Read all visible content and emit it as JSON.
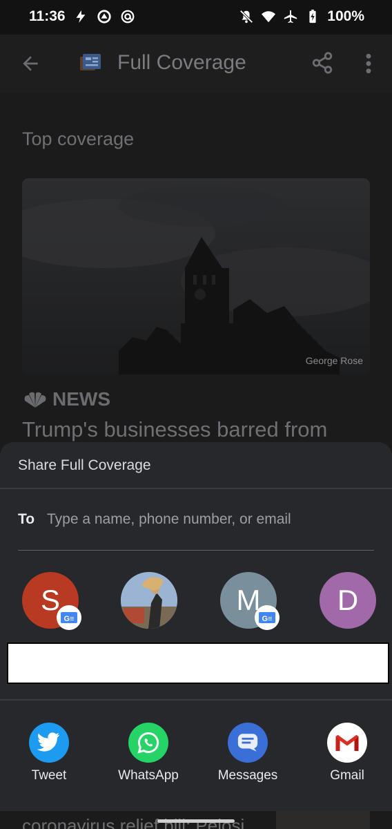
{
  "status_bar": {
    "time": "11:36",
    "battery": "100%",
    "left_icons": [
      "flash-icon",
      "sync-app-icon",
      "at-sign-icon"
    ],
    "right_icons": [
      "bell-off-icon",
      "wifi-icon",
      "airplane-icon",
      "battery-charging-icon"
    ]
  },
  "app_bar": {
    "title": "Full Coverage",
    "icons": [
      "back-arrow-icon",
      "google-news-logo-icon",
      "share-icon",
      "more-vert-icon"
    ]
  },
  "content": {
    "section_title": "Top coverage",
    "photo_credit": "George Rose",
    "source": "NEWS",
    "headline": "Trump's businesses barred from",
    "peek_text": "coronavirus relief bill: Pelosi"
  },
  "share_sheet": {
    "title": "Share Full Coverage",
    "to_label": "To",
    "to_placeholder": "Type a name, phone number, or email",
    "contacts": [
      {
        "initial": "S",
        "color": "#b83a22",
        "badge": "G≡"
      },
      {
        "initial": "",
        "color": "#8aa6c8",
        "badge": ""
      },
      {
        "initial": "M",
        "color": "#7a8f9c",
        "badge": "G≡"
      },
      {
        "initial": "D",
        "color": "#a06aa8",
        "badge": ""
      }
    ],
    "apps": [
      {
        "label": "Tweet",
        "color": "#1d9bf0"
      },
      {
        "label": "WhatsApp",
        "color": "#25d366"
      },
      {
        "label": "Messages",
        "color": "#3a6fd8"
      },
      {
        "label": "Gmail",
        "color": "#ffffff"
      }
    ]
  }
}
